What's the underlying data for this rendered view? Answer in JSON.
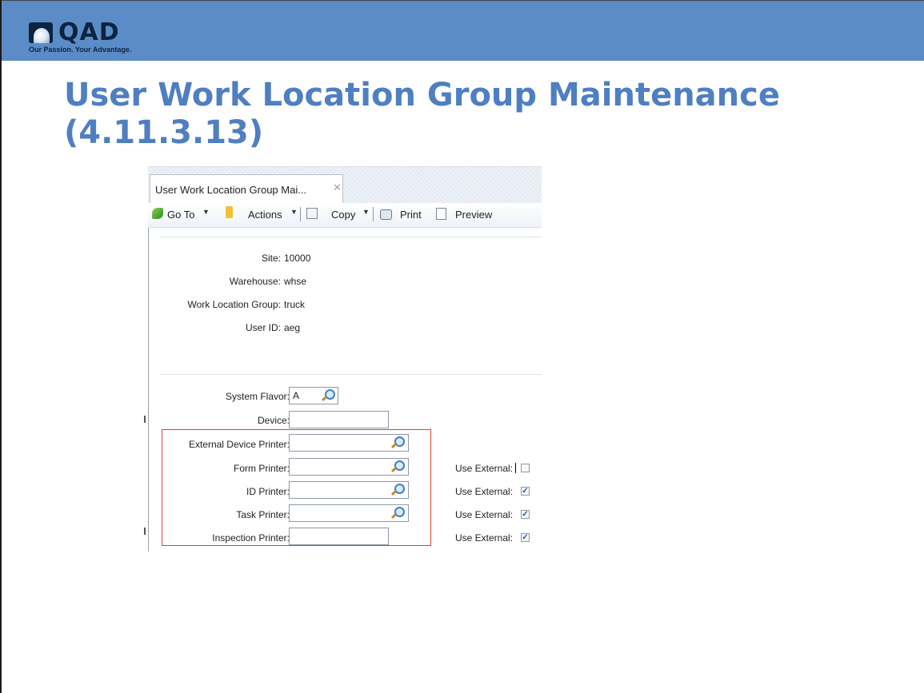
{
  "banner": {
    "logo_text": "QAD",
    "tagline": "Our Passion. Your Advantage."
  },
  "slide": {
    "title_line1": "User Work Location Group Maintenance",
    "title_line2": "(4.11.3.13)"
  },
  "screen": {
    "tab": {
      "label": "User Work Location Group Mai...",
      "close": "✕"
    },
    "toolbar": {
      "goto": "Go To",
      "actions": "Actions",
      "copy": "Copy",
      "print": "Print",
      "preview": "Preview",
      "caret": "▼"
    },
    "header_fields": [
      {
        "label": "Site:",
        "value": "10000"
      },
      {
        "label": "Warehouse:",
        "value": "whse"
      },
      {
        "label": "Work Location Group:",
        "value": "truck"
      },
      {
        "label": "User ID:",
        "value": "aeg"
      }
    ],
    "detail_fields": {
      "system_flavor": {
        "label": "System Flavor:",
        "value": "A"
      },
      "device": {
        "label": "Device:",
        "value": ""
      },
      "external_device_printer": {
        "label": "External Device Printer:",
        "value": ""
      },
      "form_printer": {
        "label": "Form Printer:",
        "value": "",
        "use_external_label": "Use External:",
        "use_external_checked": false
      },
      "id_printer": {
        "label": "ID Printer:",
        "value": "",
        "use_external_label": "Use External:",
        "use_external_checked": true
      },
      "task_printer": {
        "label": "Task Printer:",
        "value": "",
        "use_external_label": "Use External:",
        "use_external_checked": true
      },
      "inspection_printer": {
        "label": "Inspection Printer:",
        "value": "",
        "use_external_label": "Use External:",
        "use_external_checked": true
      }
    },
    "check_mark": "✓",
    "colors": {
      "banner": "#5b8cc7",
      "title": "#4f7fc2",
      "highlight_box": "#d0472c"
    }
  }
}
